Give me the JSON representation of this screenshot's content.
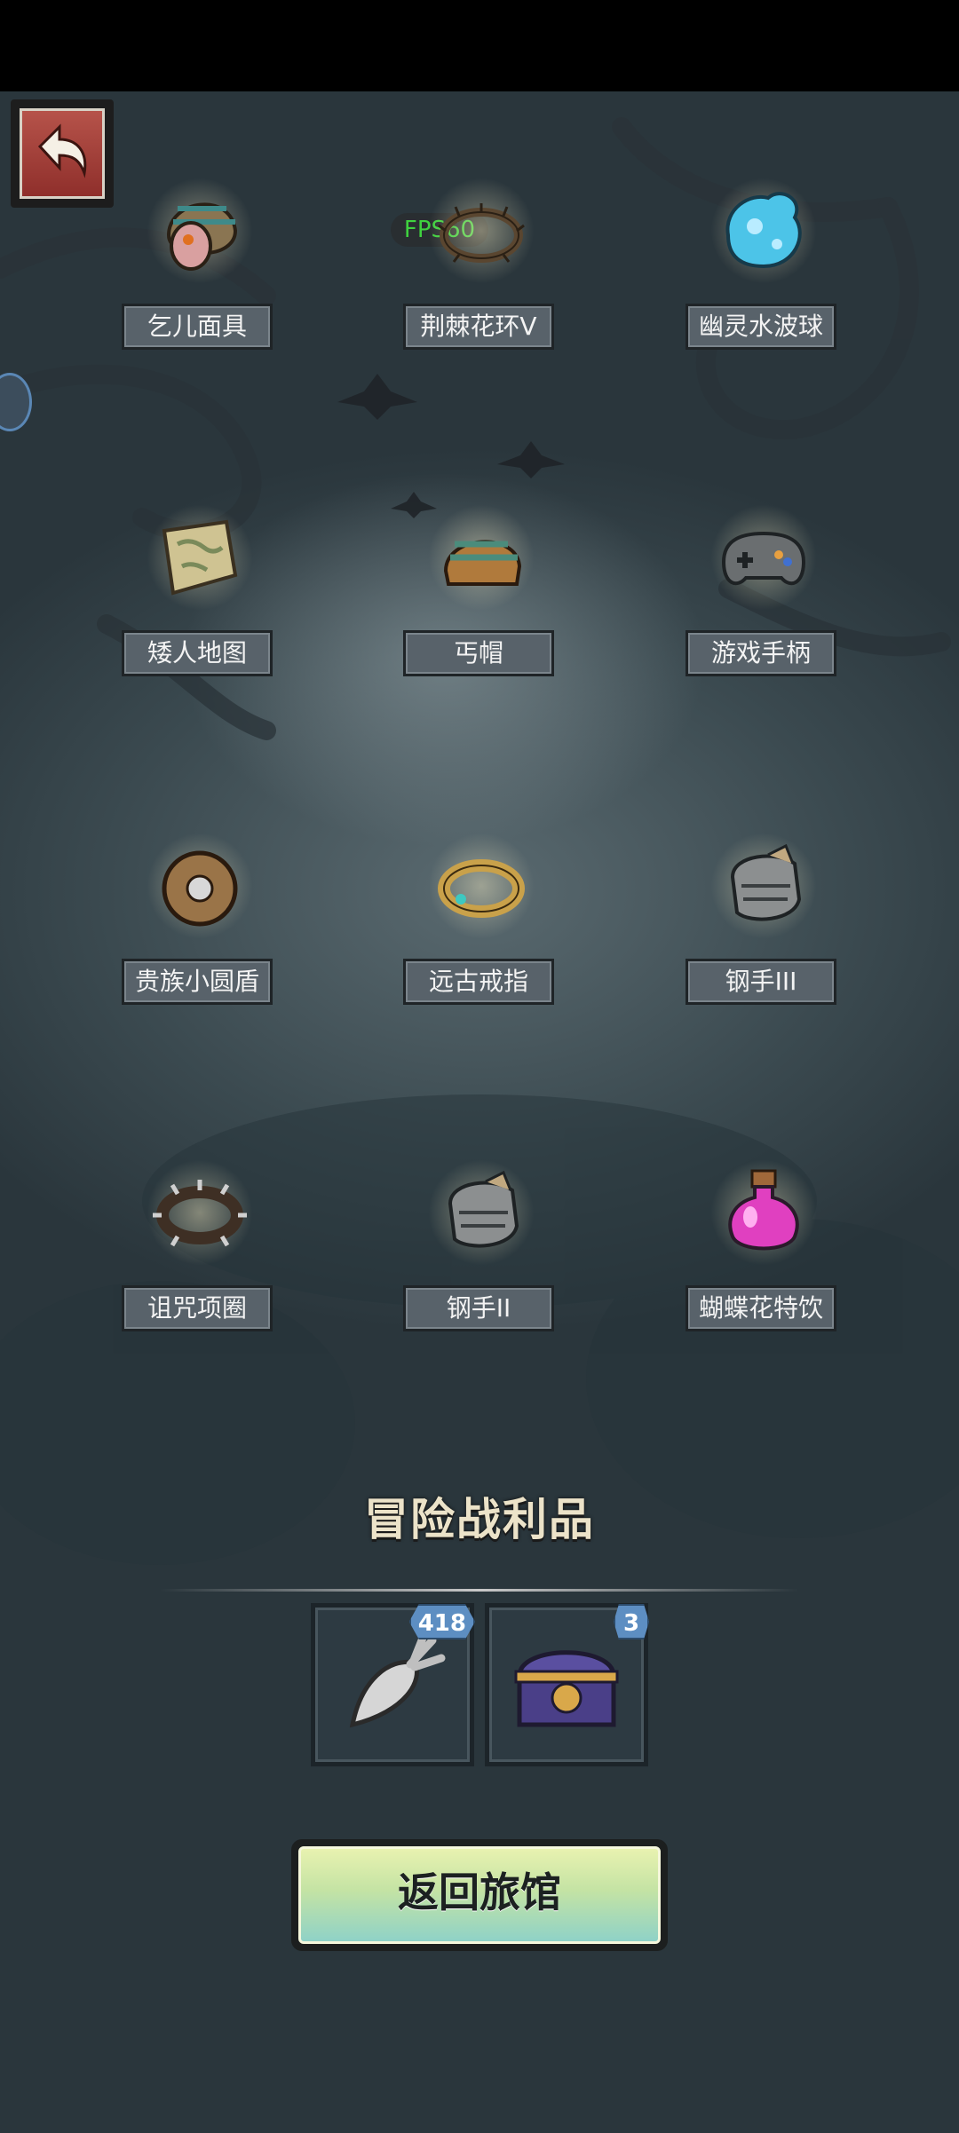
{
  "overlay": {
    "fps": "FPS60"
  },
  "back_button": {
    "icon": "return-arrow-icon"
  },
  "items": [
    {
      "label": "乞儿面具",
      "icon": "beggar-mask-icon"
    },
    {
      "label": "荆棘花环V",
      "icon": "thorn-wreath-icon"
    },
    {
      "label": "幽灵水波球",
      "icon": "ghost-water-orb-icon"
    },
    {
      "label": "矮人地图",
      "icon": "dwarf-map-icon"
    },
    {
      "label": "丐帽",
      "icon": "beggar-hat-icon"
    },
    {
      "label": "游戏手柄",
      "icon": "gamepad-icon"
    },
    {
      "label": "贵族小圆盾",
      "icon": "noble-buckler-icon"
    },
    {
      "label": "远古戒指",
      "icon": "ancient-ring-icon"
    },
    {
      "label": "钢手III",
      "icon": "steel-gauntlet-icon"
    },
    {
      "label": "诅咒项圈",
      "icon": "cursed-collar-icon"
    },
    {
      "label": "钢手II",
      "icon": "steel-gauntlet-icon"
    },
    {
      "label": "蝴蝶花特饮",
      "icon": "potion-icon"
    }
  ],
  "loot": {
    "title": "冒险战利品",
    "slots": [
      {
        "icon": "carrot-icon",
        "count": "418"
      },
      {
        "icon": "treasure-chest-icon",
        "count": "3"
      }
    ]
  },
  "return_button": {
    "label": "返回旅馆"
  },
  "colors": {
    "label_bg": "#58626a",
    "fps_text": "#3fd23f",
    "badge": "#5d8ec2",
    "button_top": "#e8f2b0",
    "button_bottom": "#8fd2c7"
  }
}
